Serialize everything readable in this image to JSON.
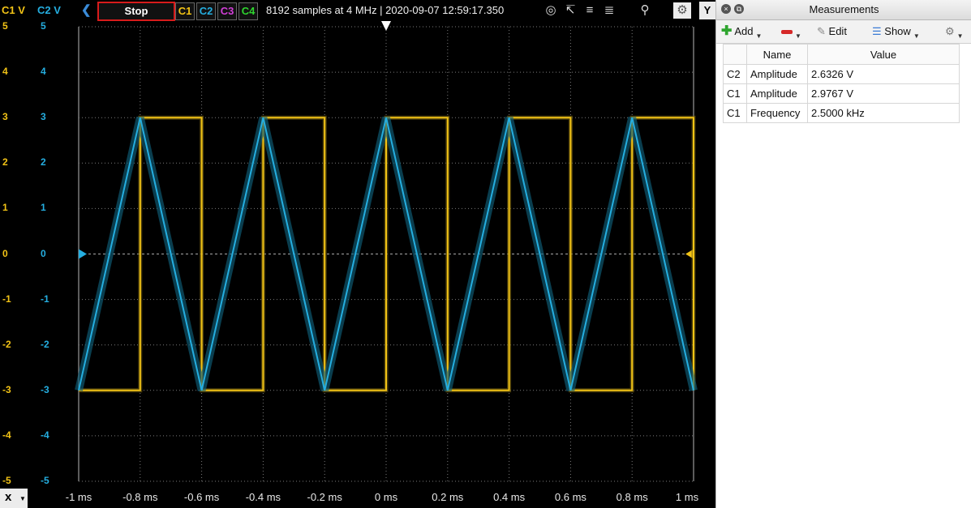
{
  "toolbar": {
    "c1_axis": "C1 V",
    "c2_axis": "C2 V",
    "stop_label": "Stop",
    "channels": [
      "C1",
      "C2",
      "C3",
      "C4"
    ],
    "channel_colors": [
      "#f2c316",
      "#25aee0",
      "#d23fd8",
      "#2fd52f"
    ],
    "status": "8192 samples at 4 MHz | 2020-09-07 12:59:17.350",
    "y_button": "Y"
  },
  "axes": {
    "y_ticks": [
      "5",
      "4",
      "3",
      "2",
      "1",
      "0",
      "-1",
      "-2",
      "-3",
      "-4",
      "-5"
    ],
    "x_ticks": [
      "-1 ms",
      "-0.8 ms",
      "-0.6 ms",
      "-0.4 ms",
      "-0.2 ms",
      "0 ms",
      "0.2 ms",
      "0.4 ms",
      "0.6 ms",
      "0.8 ms",
      "1 ms"
    ],
    "x_button": "x"
  },
  "chart_data": {
    "type": "line",
    "x_unit": "ms",
    "y_unit": "V",
    "xlim": [
      -1,
      1
    ],
    "ylim": [
      -5,
      5
    ],
    "grid": true,
    "series": [
      {
        "name": "C1",
        "color": "#f2c316",
        "shape": "square",
        "period_ms": 0.4,
        "high": 3.0,
        "low": -3.0,
        "rising_edges_ms": [
          -0.8,
          -0.4,
          0.0,
          0.4,
          0.8
        ],
        "falling_edges_ms": [
          -0.6,
          -0.2,
          0.2,
          0.6,
          1.0
        ]
      },
      {
        "name": "C2",
        "color": "#25aee0",
        "shape": "triangle",
        "period_ms": 0.4,
        "peak": 3.0,
        "trough": -3.0,
        "peaks_ms": [
          -0.8,
          -0.4,
          0.0,
          0.4,
          0.8
        ],
        "troughs_ms": [
          -1.0,
          -0.6,
          -0.2,
          0.2,
          0.6,
          1.0
        ]
      }
    ]
  },
  "panel": {
    "title": "Measurements",
    "add_label": "Add",
    "edit_label": "Edit",
    "show_label": "Show",
    "headers": [
      "Name",
      "Value"
    ],
    "rows": [
      {
        "channel": "C2",
        "name": "Amplitude",
        "value": "2.6326 V"
      },
      {
        "channel": "C1",
        "name": "Amplitude",
        "value": "2.9767 V"
      },
      {
        "channel": "C1",
        "name": "Frequency",
        "value": "2.5000 kHz"
      }
    ]
  }
}
